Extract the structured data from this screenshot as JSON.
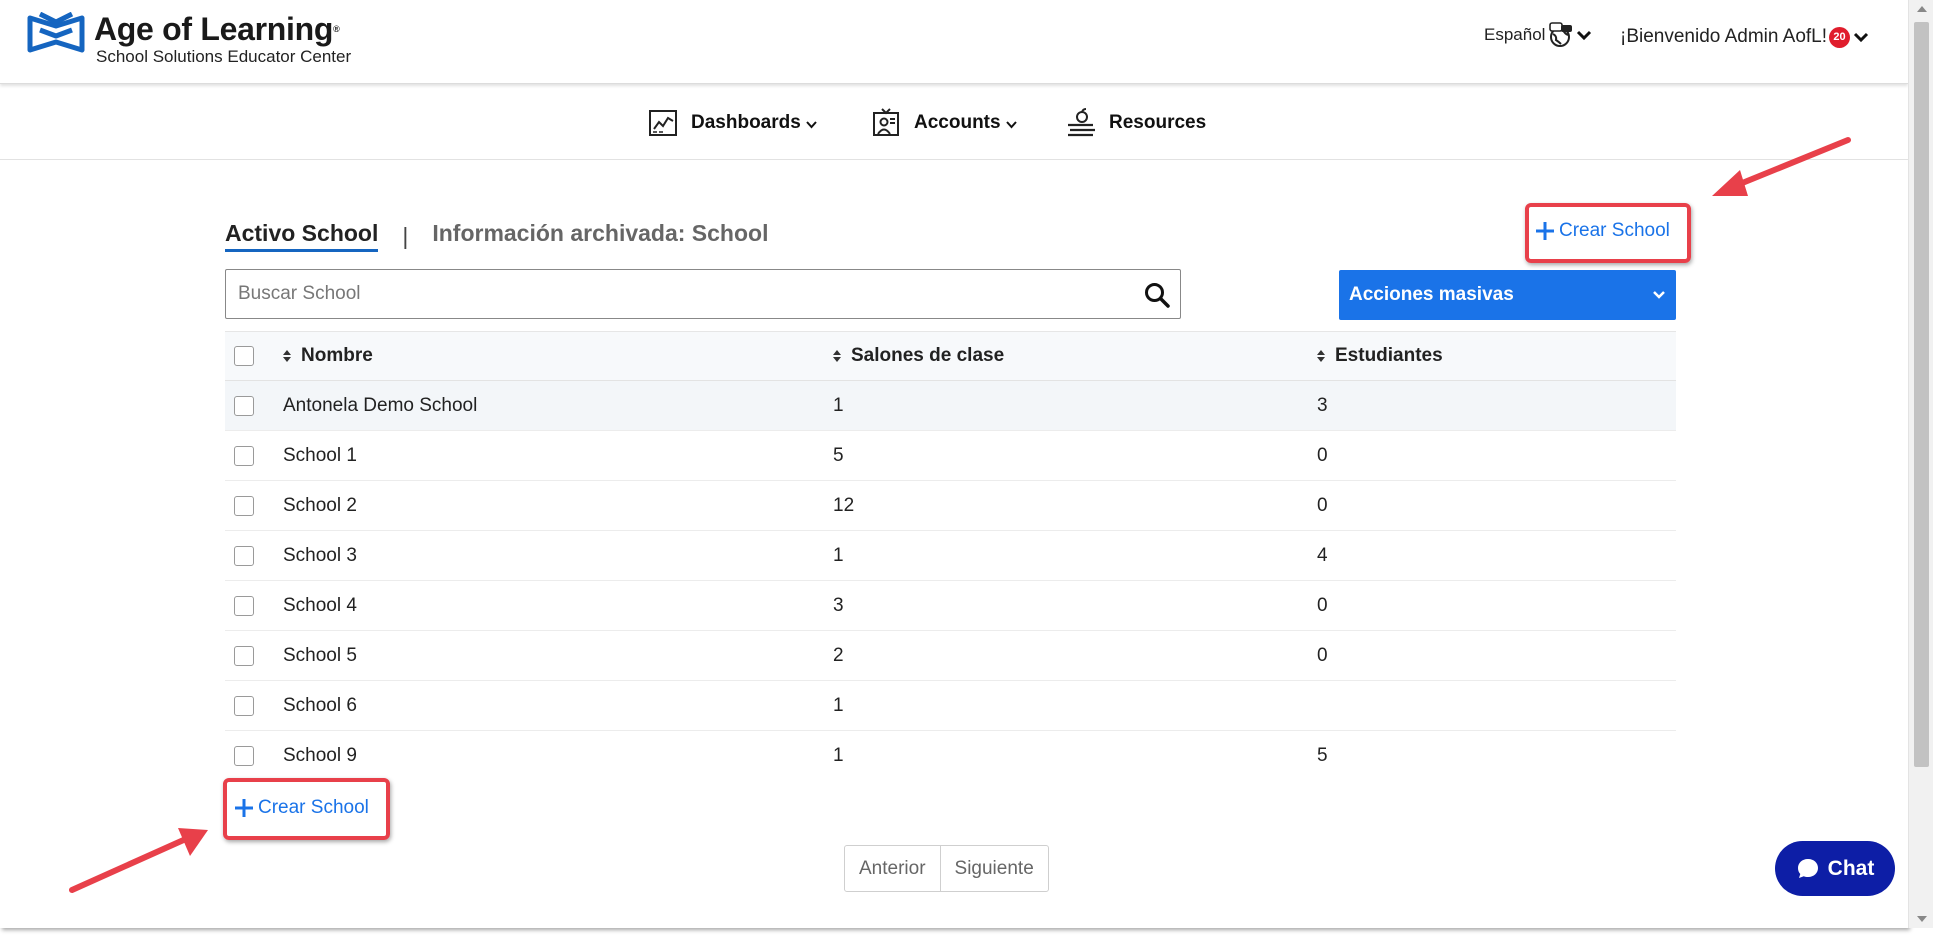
{
  "header": {
    "logo_title": "Age of Learning",
    "logo_reg": "®",
    "logo_subtitle": "School Solutions Educator Center",
    "language": "Español",
    "welcome": "¡Bienvenido Admin AofL!",
    "notification_count": "20"
  },
  "nav": {
    "items": [
      {
        "label": "Dashboards",
        "icon": "chart-board-icon",
        "has_dropdown": true
      },
      {
        "label": "Accounts",
        "icon": "teacher-board-icon",
        "has_dropdown": true
      },
      {
        "label": "Resources",
        "icon": "books-apple-icon",
        "has_dropdown": false
      }
    ]
  },
  "tabs": {
    "active": "Activo School",
    "separator": "|",
    "archived": "Información archivada: School"
  },
  "actions": {
    "create_label": "Crear School",
    "bulk_label": "Acciones masivas"
  },
  "search": {
    "placeholder": "Buscar School",
    "value": ""
  },
  "table": {
    "columns": [
      "Nombre",
      "Salones de clase",
      "Estudiantes"
    ],
    "rows": [
      {
        "name": "Antonela Demo School",
        "classrooms": "1",
        "students": "3"
      },
      {
        "name": "School 1",
        "classrooms": "5",
        "students": "0"
      },
      {
        "name": "School 2",
        "classrooms": "12",
        "students": "0"
      },
      {
        "name": "School 3",
        "classrooms": "1",
        "students": "4"
      },
      {
        "name": "School 4",
        "classrooms": "3",
        "students": "0"
      },
      {
        "name": "School 5",
        "classrooms": "2",
        "students": "0"
      },
      {
        "name": "School 6",
        "classrooms": "1",
        "students": ""
      },
      {
        "name": "School 9",
        "classrooms": "1",
        "students": "5"
      }
    ]
  },
  "pagination": {
    "prev": "Anterior",
    "next": "Siguiente"
  },
  "chat": {
    "label": "Chat"
  },
  "colors": {
    "brand_blue": "#1a73e8",
    "underline_blue": "#1565c0",
    "chat_navy": "#0d1ea6",
    "highlight_red": "#e8404a",
    "badge_red": "#e01d2c"
  }
}
